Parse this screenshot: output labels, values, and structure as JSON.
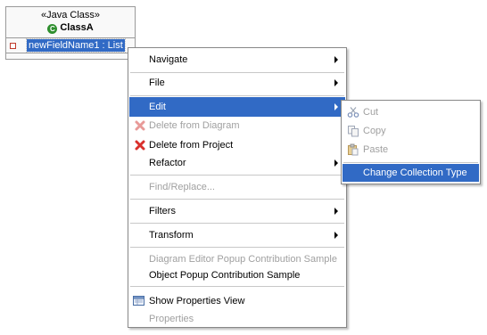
{
  "uml_class": {
    "stereotype": "«Java Class»",
    "name": "ClassA",
    "class_icon": "C",
    "field": "newFieldName1 : List"
  },
  "context_menu": {
    "navigate": "Navigate",
    "file": "File",
    "edit": "Edit",
    "delete_from_diagram": "Delete from Diagram",
    "delete_from_project": "Delete from Project",
    "refactor": "Refactor",
    "find_replace": "Find/Replace...",
    "filters": "Filters",
    "transform": "Transform",
    "diagram_editor_sample": "Diagram Editor Popup Contribution Sample",
    "object_popup_sample": "Object  Popup Contribution Sample",
    "show_properties_view": "Show Properties View",
    "properties": "Properties"
  },
  "edit_submenu": {
    "cut": "Cut",
    "copy": "Copy",
    "paste": "Paste",
    "change_collection_type": "Change Collection Type"
  },
  "colors": {
    "selection": "#316ac5",
    "disabled_text": "#a0a0a0",
    "delete_icon": "#d9302c"
  },
  "icons": [
    "class-icon",
    "field-icon",
    "delete-x-icon",
    "cut-icon",
    "copy-icon",
    "paste-icon",
    "properties-view-icon",
    "submenu-arrow-icon"
  ]
}
